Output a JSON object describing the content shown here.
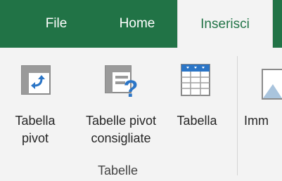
{
  "tabs": [
    {
      "label": "File"
    },
    {
      "label": "Home"
    },
    {
      "label": "Inserisci"
    }
  ],
  "commands": {
    "tabella_pivot": {
      "line1": "Tabella",
      "line2": "pivot",
      "icon": "pivot-table-icon"
    },
    "tabelle_pivot_consigliate": {
      "line1": "Tabelle pivot",
      "line2": "consigliate",
      "icon": "recommended-pivot-icon"
    },
    "tabella": {
      "line1": "Tabella",
      "icon": "table-icon"
    },
    "immagini": {
      "line1": "Imm",
      "icon": "picture-icon"
    }
  },
  "group": {
    "label": "Tabelle"
  },
  "colors": {
    "accent": "#217346",
    "icon_blue": "#2b75c6",
    "icon_gray": "#808080"
  }
}
